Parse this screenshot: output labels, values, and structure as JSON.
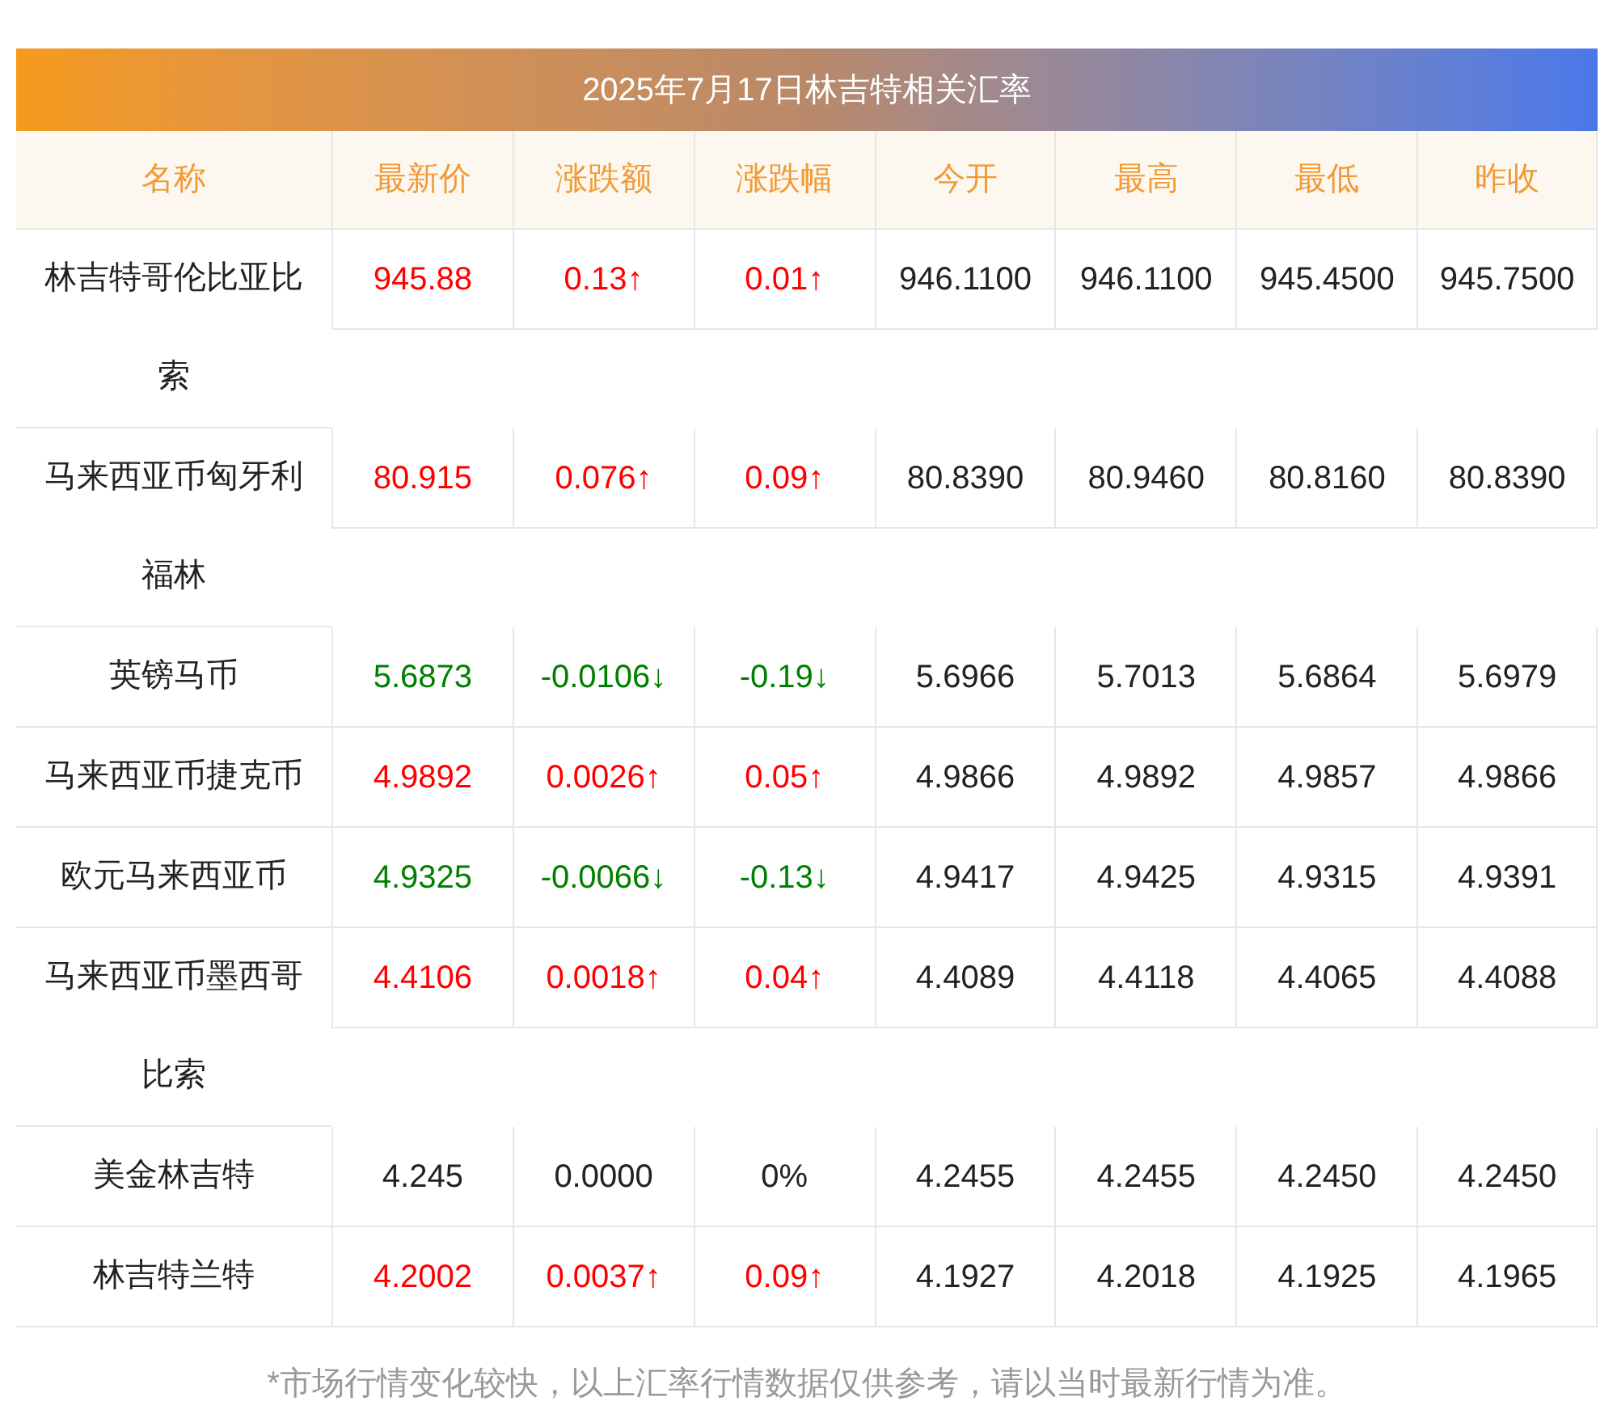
{
  "title": "2025年7月17日林吉特相关汇率",
  "columns": [
    "名称",
    "最新价",
    "涨跌额",
    "涨跌幅",
    "今开",
    "最高",
    "最低",
    "昨收"
  ],
  "rows": [
    {
      "name": "林吉特哥伦比亚比索",
      "color": "#ff0000",
      "latest": "945.88",
      "change": "0.13↑",
      "pct": "0.01↑",
      "open": "946.1100",
      "high": "946.1100",
      "low": "945.4500",
      "prev": "945.7500"
    },
    {
      "name": "马来西亚币匈牙利福林",
      "color": "#ff0000",
      "latest": "80.915",
      "change": "0.076↑",
      "pct": "0.09↑",
      "open": "80.8390",
      "high": "80.9460",
      "low": "80.8160",
      "prev": "80.8390"
    },
    {
      "name": "英镑马币",
      "color": "#008000",
      "latest": "5.6873",
      "change": "-0.0106↓",
      "pct": "-0.19↓",
      "open": "5.6966",
      "high": "5.7013",
      "low": "5.6864",
      "prev": "5.6979"
    },
    {
      "name": "马来西亚币捷克币",
      "color": "#ff0000",
      "latest": "4.9892",
      "change": "0.0026↑",
      "pct": "0.05↑",
      "open": "4.9866",
      "high": "4.9892",
      "low": "4.9857",
      "prev": "4.9866"
    },
    {
      "name": "欧元马来西亚币",
      "color": "#008000",
      "latest": "4.9325",
      "change": "-0.0066↓",
      "pct": "-0.13↓",
      "open": "4.9417",
      "high": "4.9425",
      "low": "4.9315",
      "prev": "4.9391"
    },
    {
      "name": "马来西亚币墨西哥比索",
      "color": "#ff0000",
      "latest": "4.4106",
      "change": "0.0018↑",
      "pct": "0.04↑",
      "open": "4.4089",
      "high": "4.4118",
      "low": "4.4065",
      "prev": "4.4088"
    },
    {
      "name": "美金林吉特",
      "color": "#222222",
      "latest": "4.245",
      "change": "0.0000",
      "pct": "0%",
      "open": "4.2455",
      "high": "4.2455",
      "low": "4.2450",
      "prev": "4.2450"
    },
    {
      "name": "林吉特兰特",
      "color": "#ff0000",
      "latest": "4.2002",
      "change": "0.0037↑",
      "pct": "0.09↑",
      "open": "4.1927",
      "high": "4.2018",
      "low": "4.1925",
      "prev": "4.1965"
    }
  ],
  "footnote": "*市场行情变化较快，以上汇率行情数据仅供参考，请以当时最新行情为准。"
}
